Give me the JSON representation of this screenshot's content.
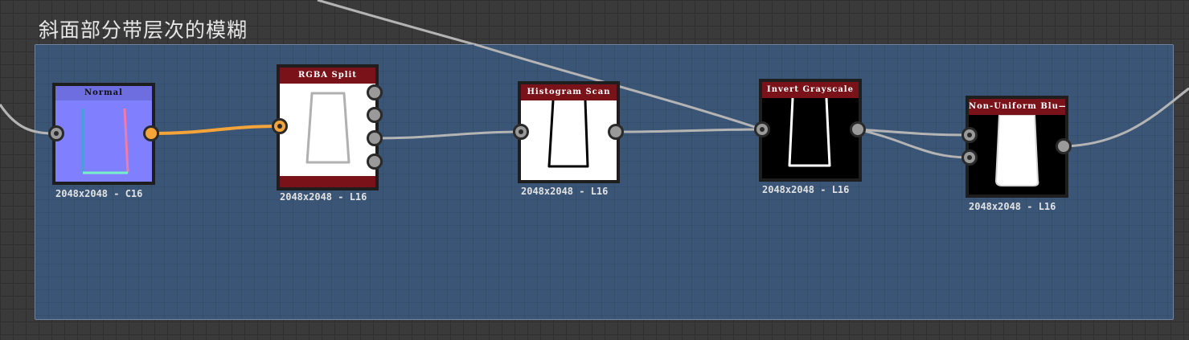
{
  "frame": {
    "title": "斜面部分带层次的模糊"
  },
  "nodes": [
    {
      "title": "Normal",
      "resolution": "2048x2048 - C16"
    },
    {
      "title": "RGBA Split",
      "resolution": "2048x2048 - L16"
    },
    {
      "title": "Histogram Scan",
      "resolution": "2048x2048 - L16"
    },
    {
      "title": "Invert Grayscale",
      "resolution": "2048x2048 - L16"
    },
    {
      "title": "Non-Uniform Blu—",
      "resolution": "2048x2048 - L16"
    }
  ],
  "colors": {
    "background": "#3a3a3a",
    "frame": "#3a5575",
    "node_title_red": "#7a1219",
    "normal_map": "#8080ff",
    "wire": "#b4b4b4",
    "wire_color_channel": "#f5a43a"
  }
}
